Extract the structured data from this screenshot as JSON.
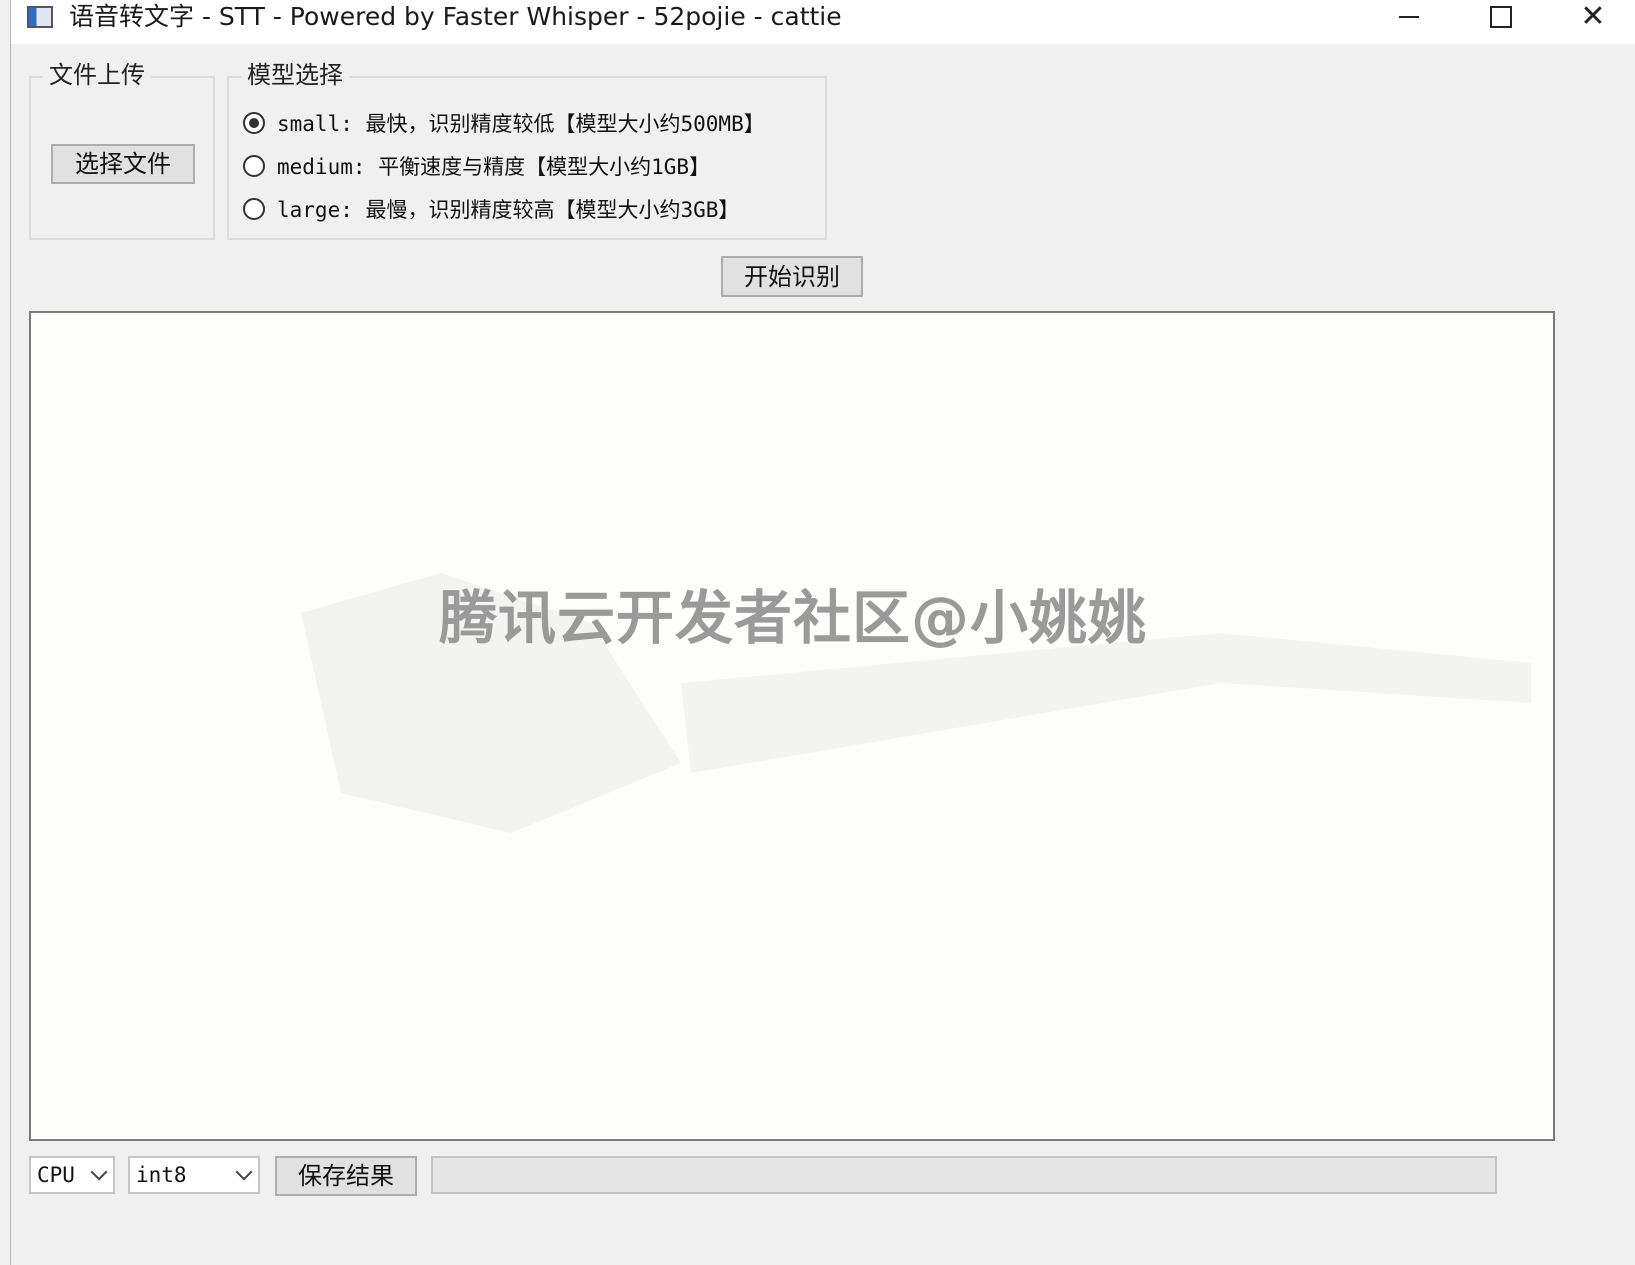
{
  "window": {
    "title": "语音转文字 - STT - Powered by Faster Whisper - 52pojie - cattie",
    "min_icon": "minimize-icon",
    "max_icon": "maximize-icon",
    "close_glyph": "✕"
  },
  "file_group": {
    "legend": "文件上传",
    "choose_button": "选择文件"
  },
  "model_group": {
    "legend": "模型选择",
    "options": [
      {
        "label": "small: 最快，识别精度较低【模型大小约500MB】",
        "checked": true
      },
      {
        "label": "medium: 平衡速度与精度【模型大小约1GB】",
        "checked": false
      },
      {
        "label": "large: 最慢，识别精度较高【模型大小约3GB】",
        "checked": false
      }
    ]
  },
  "start_button": "开始识别",
  "output": {
    "text": "",
    "watermark": "腾讯云开发者社区@小姚姚"
  },
  "bottom": {
    "device": "CPU",
    "precision": "int8",
    "save_button": "保存结果",
    "progress": 0
  },
  "colors": {
    "window_bg": "#f0f0f0",
    "button_bg": "#e1e1e1",
    "output_bg": "#fdfdfc",
    "watermark": "#9a9a9a"
  }
}
